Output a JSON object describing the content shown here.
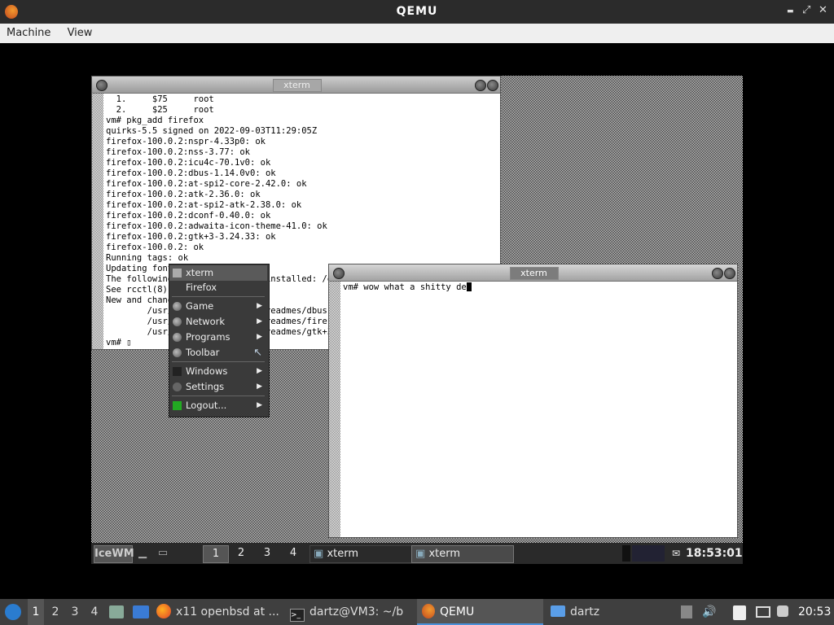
{
  "host_window": {
    "title": "QEMU",
    "min": "▬",
    "max": "⤢",
    "close": "✕"
  },
  "host_menu": [
    "Machine",
    "View"
  ],
  "xterm1": {
    "title": "xterm",
    "lines": [
      "  1.     $75     root",
      "  2.     $25     root",
      "vm# pkg_add firefox",
      "quirks-5.5 signed on 2022-09-03T11:29:05Z",
      "firefox-100.0.2:nspr-4.33p0: ok",
      "firefox-100.0.2:nss-3.77: ok",
      "firefox-100.0.2:icu4c-70.1v0: ok",
      "firefox-100.0.2:dbus-1.14.0v0: ok",
      "firefox-100.0.2:at-spi2-core-2.42.0: ok",
      "firefox-100.0.2:atk-2.36.0: ok",
      "firefox-100.0.2:at-spi2-atk-2.38.0: ok",
      "firefox-100.0.2:dconf-0.40.0: ok",
      "firefox-100.0.2:adwaita-icon-theme-41.0: ok",
      "firefox-100.0.2:gtk+3-3.24.33: ok",
      "firefox-100.0.2: ok",
      "Running tags: ok",
      "Updating font",
      "The following                  installed: /e",
      "See rcctl(8)",
      "New and chang",
      "        /usr/                  readmes/dbus",
      "        /usr/                  readmes/firef",
      "        /usr/                  readmes/gtk+3",
      "vm# ▯"
    ]
  },
  "xterm2": {
    "title": "xterm",
    "prompt": "vm# wow what a shitty de"
  },
  "start_menu": {
    "items": [
      {
        "label": "xterm",
        "icon": "terminal-icon",
        "submenu": false
      },
      {
        "label": "Firefox",
        "icon": "",
        "submenu": false
      },
      {
        "label": "Game",
        "icon": "folder-icon",
        "submenu": true
      },
      {
        "label": "Network",
        "icon": "folder-icon",
        "submenu": true
      },
      {
        "label": "Programs",
        "icon": "folder-icon",
        "submenu": true
      },
      {
        "label": "Toolbar",
        "icon": "folder-icon",
        "submenu": false
      },
      {
        "label": "Windows",
        "icon": "windows-icon",
        "submenu": true
      },
      {
        "label": "Settings",
        "icon": "settings-icon",
        "submenu": true
      },
      {
        "label": "Logout...",
        "icon": "logout-icon",
        "submenu": true
      }
    ]
  },
  "guest_taskbar": {
    "start": "IceWM",
    "workspaces": [
      "1",
      "2",
      "3",
      "4"
    ],
    "tasks": [
      "xterm",
      "xterm"
    ],
    "clock": "18:53:01"
  },
  "host_taskbar": {
    "workspaces": [
      "1",
      "2",
      "3",
      "4"
    ],
    "tasks": [
      "x11 openbsd at ...",
      "dartz@VM3: ~/b",
      "QEMU",
      "dartz"
    ],
    "clock": "20:53"
  }
}
